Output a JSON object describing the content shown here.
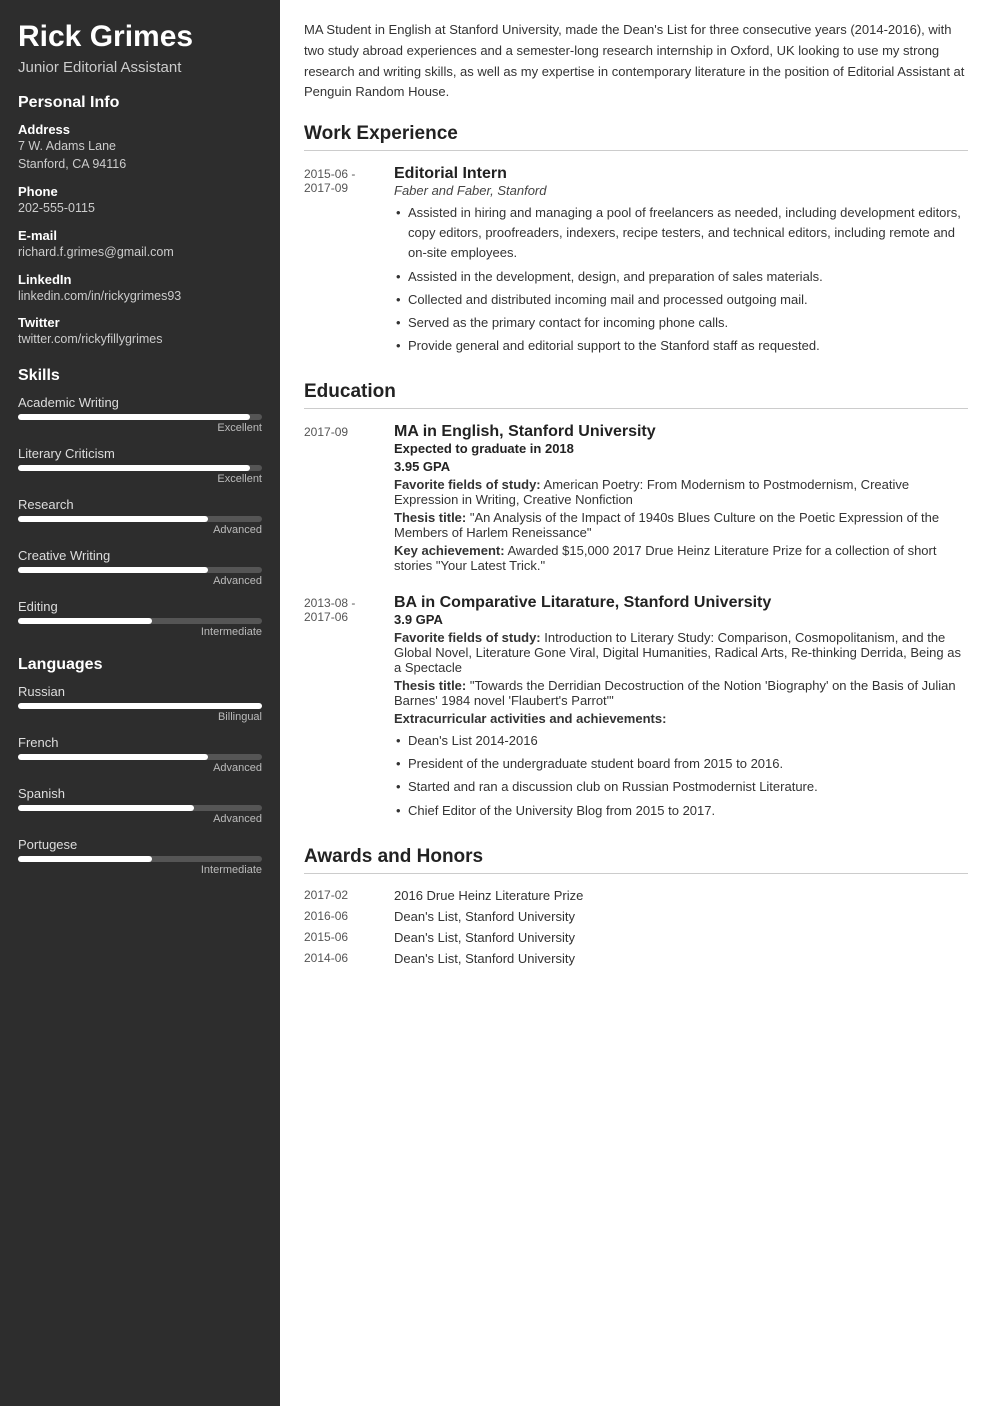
{
  "sidebar": {
    "name": "Rick Grimes",
    "title": "Junior Editorial Assistant",
    "personal_info_heading": "Personal Info",
    "address_label": "Address",
    "address_lines": [
      "7 W. Adams Lane",
      "Stanford, CA 94116"
    ],
    "phone_label": "Phone",
    "phone": "202-555-0115",
    "email_label": "E-mail",
    "email": "richard.f.grimes@gmail.com",
    "linkedin_label": "LinkedIn",
    "linkedin": "linkedin.com/in/rickygrimes93",
    "twitter_label": "Twitter",
    "twitter": "twitter.com/rickyfillygrimes",
    "skills_heading": "Skills",
    "skills": [
      {
        "name": "Academic Writing",
        "level_label": "Excellent",
        "pct": 95
      },
      {
        "name": "Literary Criticism",
        "level_label": "Excellent",
        "pct": 95
      },
      {
        "name": "Research",
        "level_label": "Advanced",
        "pct": 78
      },
      {
        "name": "Creative Writing",
        "level_label": "Advanced",
        "pct": 78
      },
      {
        "name": "Editing",
        "level_label": "Intermediate",
        "pct": 55
      }
    ],
    "languages_heading": "Languages",
    "languages": [
      {
        "name": "Russian",
        "level_label": "Billingual",
        "pct": 100
      },
      {
        "name": "French",
        "level_label": "Advanced",
        "pct": 78
      },
      {
        "name": "Spanish",
        "level_label": "Advanced",
        "pct": 72
      },
      {
        "name": "Portugese",
        "level_label": "Intermediate",
        "pct": 55
      }
    ]
  },
  "main": {
    "summary": "MA Student in English at Stanford University, made the Dean's List for three consecutive years (2014-2016), with two study abroad experiences and a semester-long research internship in Oxford, UK looking to use my strong research and writing skills, as well as my expertise in contemporary literature in the position of Editorial Assistant at Penguin Random House.",
    "work_heading": "Work Experience",
    "work_entries": [
      {
        "date": "2015-06 -\n2017-09",
        "title": "Editorial Intern",
        "subtitle": "Faber and Faber, Stanford",
        "bullets": [
          "Assisted in hiring and managing a pool of freelancers as needed, including development editors, copy editors, proofreaders, indexers, recipe testers, and technical editors, including remote and on-site employees.",
          "Assisted in the development, design, and preparation of sales materials.",
          "Collected and distributed incoming mail and processed outgoing mail.",
          "Served as the primary contact for incoming phone calls.",
          "Provide general and editorial support to the Stanford staff as requested."
        ]
      }
    ],
    "education_heading": "Education",
    "education_entries": [
      {
        "date": "2017-09",
        "title": "MA in English, Stanford University",
        "graduate": "Expected to graduate in 2018",
        "gpa": "3.95 GPA",
        "fields_label": "Favorite fields of study:",
        "fields": "American Poetry: From Modernism to Postmodernism, Creative Expression in Writing, Creative Nonfiction",
        "thesis_label": "Thesis title:",
        "thesis": "\"An Analysis of the Impact of 1940s Blues Culture on the Poetic Expression of the Members of Harlem Reneissance\"",
        "achievement_label": "Key achievement:",
        "achievement": "Awarded $15,000 2017 Drue Heinz Literature Prize for a collection of short stories \"Your Latest Trick.\""
      },
      {
        "date": "2013-08 -\n2017-06",
        "title": "BA in Comparative Litarature, Stanford University",
        "graduate": "",
        "gpa": "3.9 GPA",
        "fields_label": "Favorite fields of study:",
        "fields": "Introduction to Literary Study: Comparison, Cosmopolitanism, and the Global Novel, Literature Gone Viral, Digital Humanities, Radical Arts, Re-thinking Derrida, Being as a Spectacle",
        "thesis_label": "Thesis title:",
        "thesis": "\"Towards the Derridian Decostruction of the Notion 'Biography' on the Basis of Julian Barnes' 1984 novel 'Flaubert's Parrot'\"",
        "extra_label": "Extracurricular activities and achievements:",
        "extra_bullets": [
          "Dean's List 2014-2016",
          "President of the undergraduate student board from 2015 to 2016.",
          "Started and ran a discussion club on Russian Postmodernist Literature.",
          "Chief Editor of the University Blog from 2015 to 2017."
        ]
      }
    ],
    "awards_heading": "Awards and Honors",
    "awards": [
      {
        "date": "2017-02",
        "name": "2016 Drue Heinz Literature Prize"
      },
      {
        "date": "2016-06",
        "name": "Dean's List, Stanford University"
      },
      {
        "date": "2015-06",
        "name": "Dean's List, Stanford University"
      },
      {
        "date": "2014-06",
        "name": "Dean's List, Stanford University"
      }
    ]
  }
}
